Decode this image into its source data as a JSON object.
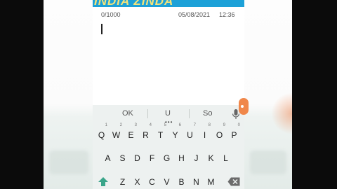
{
  "banner": {
    "text": "INDIA ZINDA"
  },
  "editor": {
    "char_count": "0/1000",
    "date": "05/08/2021",
    "time": "12:36"
  },
  "keyboard": {
    "suggestions": [
      "OK",
      "U",
      "So"
    ],
    "row1": [
      {
        "key": "Q",
        "num": "1"
      },
      {
        "key": "W",
        "num": "2"
      },
      {
        "key": "E",
        "num": "3"
      },
      {
        "key": "R",
        "num": "4"
      },
      {
        "key": "T",
        "num": "5"
      },
      {
        "key": "Y",
        "num": "6"
      },
      {
        "key": "U",
        "num": "7"
      },
      {
        "key": "I",
        "num": "8"
      },
      {
        "key": "O",
        "num": "9"
      },
      {
        "key": "P",
        "num": "0"
      }
    ],
    "row2": [
      "A",
      "S",
      "D",
      "F",
      "G",
      "H",
      "J",
      "K",
      "L"
    ],
    "row3": [
      "Z",
      "X",
      "C",
      "V",
      "B",
      "N",
      "M"
    ],
    "icons": {
      "shift": "shift-icon",
      "backspace": "backspace-icon",
      "mic": "mic-icon"
    }
  },
  "colors": {
    "banner_bg": "#1da1d8",
    "banner_text": "#f3e37a",
    "keyboard_bg": "#edf1f0",
    "shift_accent": "#3aa58a",
    "orange_accent": "#f0874a"
  }
}
